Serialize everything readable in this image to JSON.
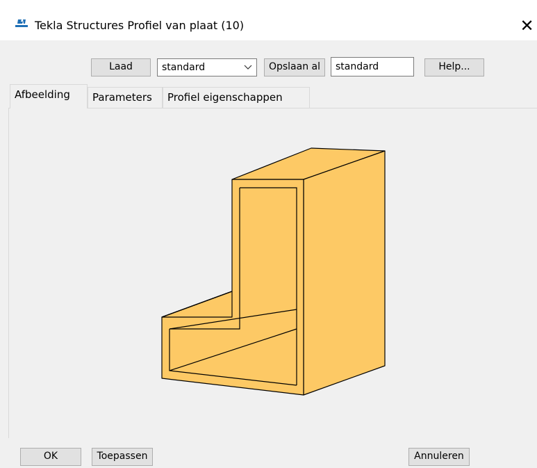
{
  "titlebar": {
    "title": "Tekla Structures  Profiel van plaat  (10)",
    "app_icon": "tekla-logo-icon",
    "close_icon": "close-icon",
    "close_glyph": "✕"
  },
  "toolbar": {
    "load_label": "Laad",
    "preset_value": "standard",
    "save_as_label": "Opslaan al",
    "save_as_value": "standard",
    "help_label": "Help..."
  },
  "tabs": [
    {
      "label": "Afbeelding",
      "active": true
    },
    {
      "label": "Parameters",
      "active": false
    },
    {
      "label": "Profiel eigenschappen",
      "active": false
    }
  ],
  "profile_image": {
    "icon": "plate-profile-3d-icon",
    "fill_color": "#fdc965",
    "stroke_color": "#000000"
  },
  "footer": {
    "ok_label": "OK",
    "apply_label": "Toepassen",
    "cancel_label": "Annuleren"
  }
}
